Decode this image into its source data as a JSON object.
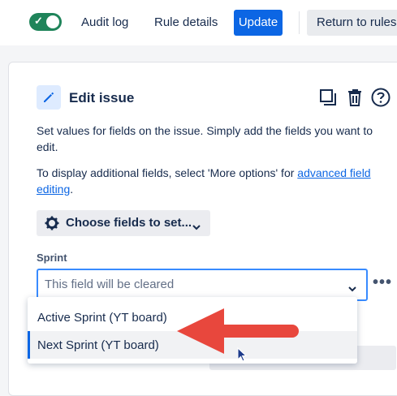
{
  "toolbar": {
    "toggle_state": "on",
    "audit_log": "Audit log",
    "rule_details": "Rule details",
    "update": "Update",
    "return_to_rules": "Return to rules"
  },
  "action": {
    "title": "Edit issue",
    "description": "Set values for fields on the issue. Simply add the fields you want to edit.",
    "more_prefix": "To display additional fields, select 'More options' for ",
    "more_link": "advanced field editing",
    "more_suffix": ".",
    "choose_fields": "Choose fields to set...",
    "icons": [
      "duplicate-icon",
      "trash-icon",
      "help-icon"
    ]
  },
  "sprint": {
    "label": "Sprint",
    "placeholder": "This field will be cleared",
    "more": "•••",
    "options": [
      "Active Sprint (YT board)",
      "Next Sprint (YT board)"
    ],
    "highlighted_index": 1
  },
  "colors": {
    "primary": "#0c66e4",
    "toggle": "#1f845a",
    "annotation_arrow": "#e8473d"
  }
}
